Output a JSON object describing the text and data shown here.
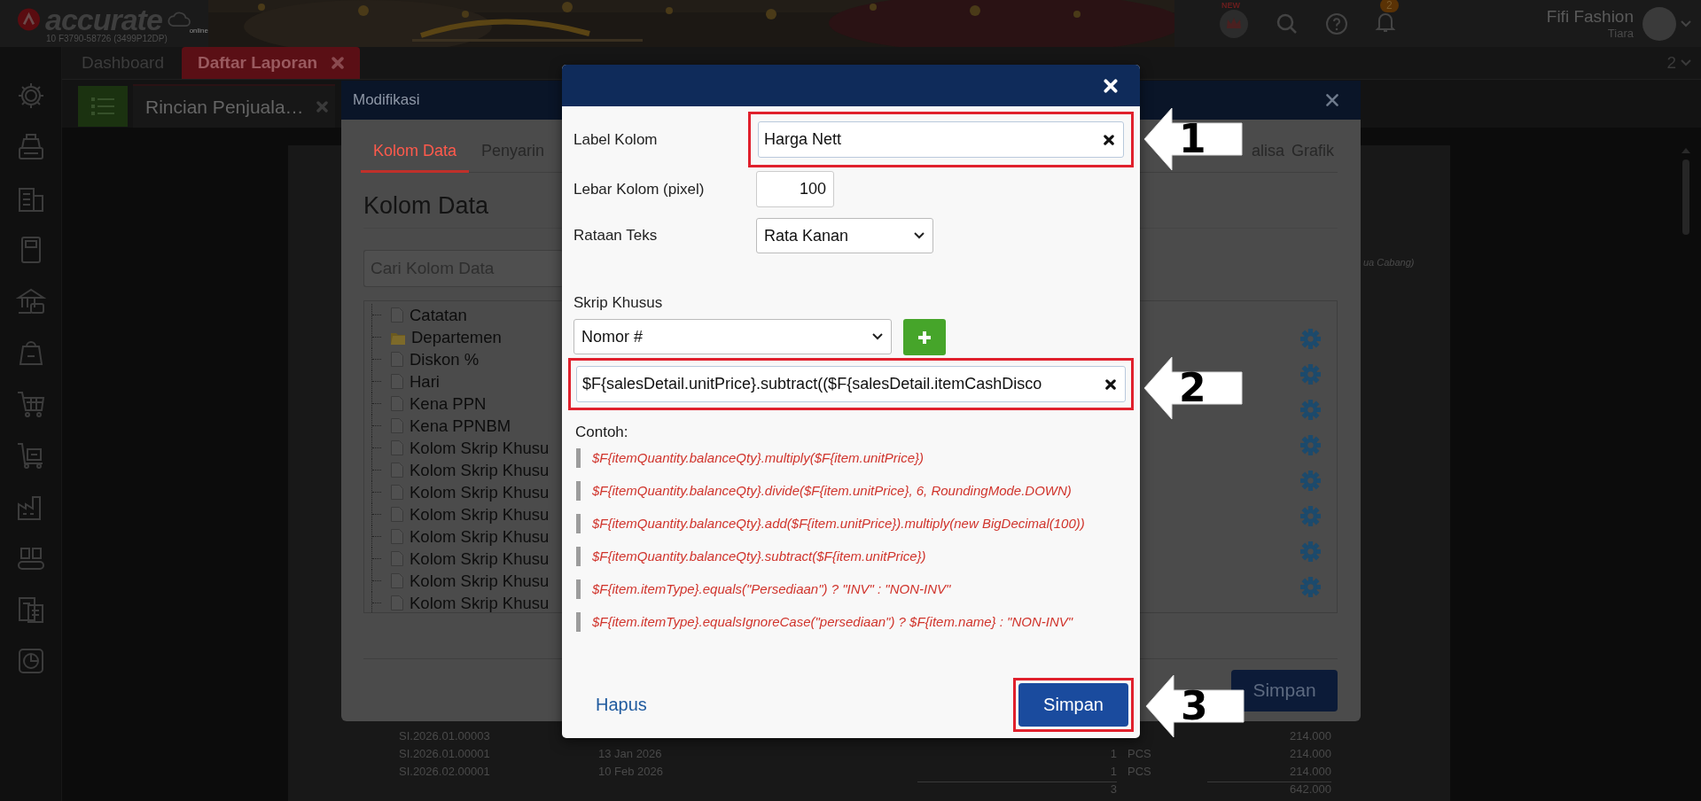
{
  "header": {
    "logo": "accurate",
    "logo_sub": "online",
    "account_code": "10 F3790-58726 (3499P12DP)",
    "new_badge": "NEW",
    "notification_count": "2",
    "company": "Fifi Fashion",
    "user": "Tiara"
  },
  "tabs": [
    {
      "label": "Dashboard",
      "selected": false,
      "closable": false
    },
    {
      "label": "Daftar Laporan",
      "selected": true,
      "closable": true
    }
  ],
  "tab_count": "2",
  "report_tabs": [
    {
      "label": "Rincian Penjuala…",
      "selected": true
    }
  ],
  "report": {
    "note": "ua Cabang)",
    "rows": [
      {
        "number": "SI.2026.01.00003",
        "amount": "214.000"
      },
      {
        "number": "SI.2026.01.00001",
        "date": "13 Jan 2026",
        "qty": "1",
        "unit": "PCS",
        "amount": "214.000"
      },
      {
        "number": "SI.2026.02.00001",
        "date": "10 Feb 2026",
        "qty": "1",
        "unit": "PCS",
        "amount": "214.000"
      }
    ],
    "total": {
      "qty": "3",
      "amount": "642.000"
    }
  },
  "modify_dialog": {
    "title": "Modifikasi",
    "tabs": [
      {
        "label": "Kolom Data",
        "selected": true
      },
      {
        "label": "Penyarin",
        "selected": false
      },
      {
        "label": "alisa",
        "selected": false
      },
      {
        "label": "Grafik",
        "selected": false
      }
    ],
    "heading": "Kolom Data",
    "search": {
      "placeholder": "Cari Kolom Data"
    },
    "tree": [
      {
        "label": "Catatan",
        "kind": "file"
      },
      {
        "label": "Departemen",
        "kind": "folder"
      },
      {
        "label": "Diskon %",
        "kind": "file"
      },
      {
        "label": "Hari",
        "kind": "file"
      },
      {
        "label": "Kena PPN",
        "kind": "file"
      },
      {
        "label": "Kena PPNBM",
        "kind": "file"
      },
      {
        "label": "Kolom Skrip Khusu",
        "kind": "file"
      },
      {
        "label": "Kolom Skrip Khusu",
        "kind": "file"
      },
      {
        "label": "Kolom Skrip Khusu",
        "kind": "file"
      },
      {
        "label": "Kolom Skrip Khusu",
        "kind": "file"
      },
      {
        "label": "Kolom Skrip Khusu",
        "kind": "file"
      },
      {
        "label": "Kolom Skrip Khusu",
        "kind": "file"
      },
      {
        "label": "Kolom Skrip Khusu",
        "kind": "file"
      },
      {
        "label": "Kolom Skrip Khusu",
        "kind": "file"
      }
    ],
    "save": "Simpan"
  },
  "column_editor": {
    "label_field": {
      "label": "Label Kolom",
      "value": "Harga Nett",
      "highlighted": true
    },
    "width_field": {
      "label": "Lebar Kolom (pixel)",
      "value": "100"
    },
    "align_field": {
      "label": "Rataan Teks",
      "value": "Rata Kanan"
    },
    "script": {
      "label": "Skrip Khusus",
      "select": "Nomor #",
      "value": "$F{salesDetail.unitPrice}.subtract(($F{salesDetail.itemCashDisco",
      "highlighted": true
    },
    "examples_label": "Contoh:",
    "examples": [
      "$F{itemQuantity.balanceQty}.multiply($F{item.unitPrice})",
      "$F{itemQuantity.balanceQty}.divide($F{item.unitPrice}, 6, RoundingMode.DOWN)",
      "$F{itemQuantity.balanceQty}.add($F{item.unitPrice}).multiply(new BigDecimal(100))",
      "$F{itemQuantity.balanceQty}.subtract($F{item.unitPrice})",
      "$F{item.itemType}.equals(\"Persediaan\") ? \"INV\" : \"NON-INV\"",
      "$F{item.itemType}.equalsIgnoreCase(\"persediaan\") ? $F{item.name} : \"NON-INV\""
    ],
    "delete": "Hapus",
    "save": {
      "label": "Simpan",
      "highlighted": true
    }
  },
  "callouts": [
    {
      "number": "1"
    },
    {
      "number": "2"
    },
    {
      "number": "3"
    }
  ]
}
